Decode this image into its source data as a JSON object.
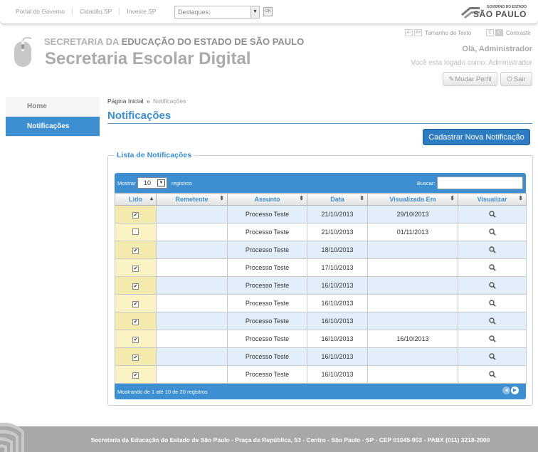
{
  "topbar": {
    "links": [
      "Portal do Governo",
      "Cidadão.SP",
      "Investe SP"
    ],
    "destaques_placeholder": "Destaques:",
    "ok_label": "OK",
    "gov_small": "GOVERNO DO ESTADO",
    "gov_big": "SÃO PAULO"
  },
  "header": {
    "secretaria_prefix": "SECRETARIA DA",
    "secretaria_bold": "EDUCAÇÃO DO ESTADO DE SÃO PAULO",
    "app_title": "Secretaria Escolar Digital"
  },
  "accessibility": {
    "font_minus": "A-",
    "font_plus": "A+",
    "font_label": "Tamanho do Texto",
    "contrast_c1": "C",
    "contrast_c2": "C",
    "contrast_label": "Contraste"
  },
  "user": {
    "greeting": "Olá, Administrador",
    "logged_as": "Você esta logado como: Administrador",
    "change_profile": "Mudar Perfil",
    "logout": "Sair"
  },
  "sidebar": {
    "items": [
      {
        "label": "Home"
      },
      {
        "label": "Notificações"
      }
    ]
  },
  "breadcrumb": {
    "home": "Página Inicial",
    "sep": "»",
    "current": "Notificações"
  },
  "page": {
    "title": "Notificações",
    "new_button": "Cadastrar Nova Notificação",
    "fieldset_legend": "Lista de Notificações"
  },
  "table": {
    "show_label": "Mostrar",
    "page_size": "10",
    "records_label": "registros",
    "search_label": "Buscar:",
    "columns": [
      "Lido",
      "Remetente",
      "Assunto",
      "Data",
      "Visualizada Em",
      "Visualizar"
    ],
    "rows": [
      {
        "lido": true,
        "remetente": "",
        "assunto": "Processo Teste",
        "data": "21/10/2013",
        "visualizada": "29/10/2013"
      },
      {
        "lido": false,
        "remetente": "",
        "assunto": "Processo Teste",
        "data": "21/10/2013",
        "visualizada": "01/11/2013"
      },
      {
        "lido": true,
        "remetente": "",
        "assunto": "Processo Teste",
        "data": "18/10/2013",
        "visualizada": ""
      },
      {
        "lido": true,
        "remetente": "",
        "assunto": "Processo Teste",
        "data": "17/10/2013",
        "visualizada": ""
      },
      {
        "lido": true,
        "remetente": "",
        "assunto": "Processo Teste",
        "data": "16/10/2013",
        "visualizada": ""
      },
      {
        "lido": true,
        "remetente": "",
        "assunto": "Processo Teste",
        "data": "16/10/2013",
        "visualizada": ""
      },
      {
        "lido": true,
        "remetente": "",
        "assunto": "Processo Teste",
        "data": "16/10/2013",
        "visualizada": ""
      },
      {
        "lido": true,
        "remetente": "",
        "assunto": "Processo Teste",
        "data": "16/10/2013",
        "visualizada": "16/10/2013"
      },
      {
        "lido": true,
        "remetente": "",
        "assunto": "Processo Teste",
        "data": "16/10/2013",
        "visualizada": ""
      },
      {
        "lido": true,
        "remetente": "",
        "assunto": "Processo Teste",
        "data": "16/10/2013",
        "visualizada": ""
      }
    ],
    "info": "Mostrando de 1 até 10 de 20 registros"
  },
  "footer": {
    "text": "Secretaria da Educação do Estado de São Paulo - Praça da República, 53 - Centro - São Paulo - SP - CEP 01045-903 - PABX (011) 3218-2000"
  },
  "colors": {
    "accent": "#3d8fd1",
    "button": "#2d7bc0",
    "lido_bg": "#fbf3c4",
    "row_alt": "#e2eefa",
    "footer": "#a8a8a8"
  },
  "icons": [
    "mouse-logo-icon",
    "search-icon",
    "wrench-icon",
    "power-icon",
    "sort-icon",
    "checkbox-icon",
    "prev-page-icon",
    "next-page-icon",
    "caret-down-icon"
  ]
}
